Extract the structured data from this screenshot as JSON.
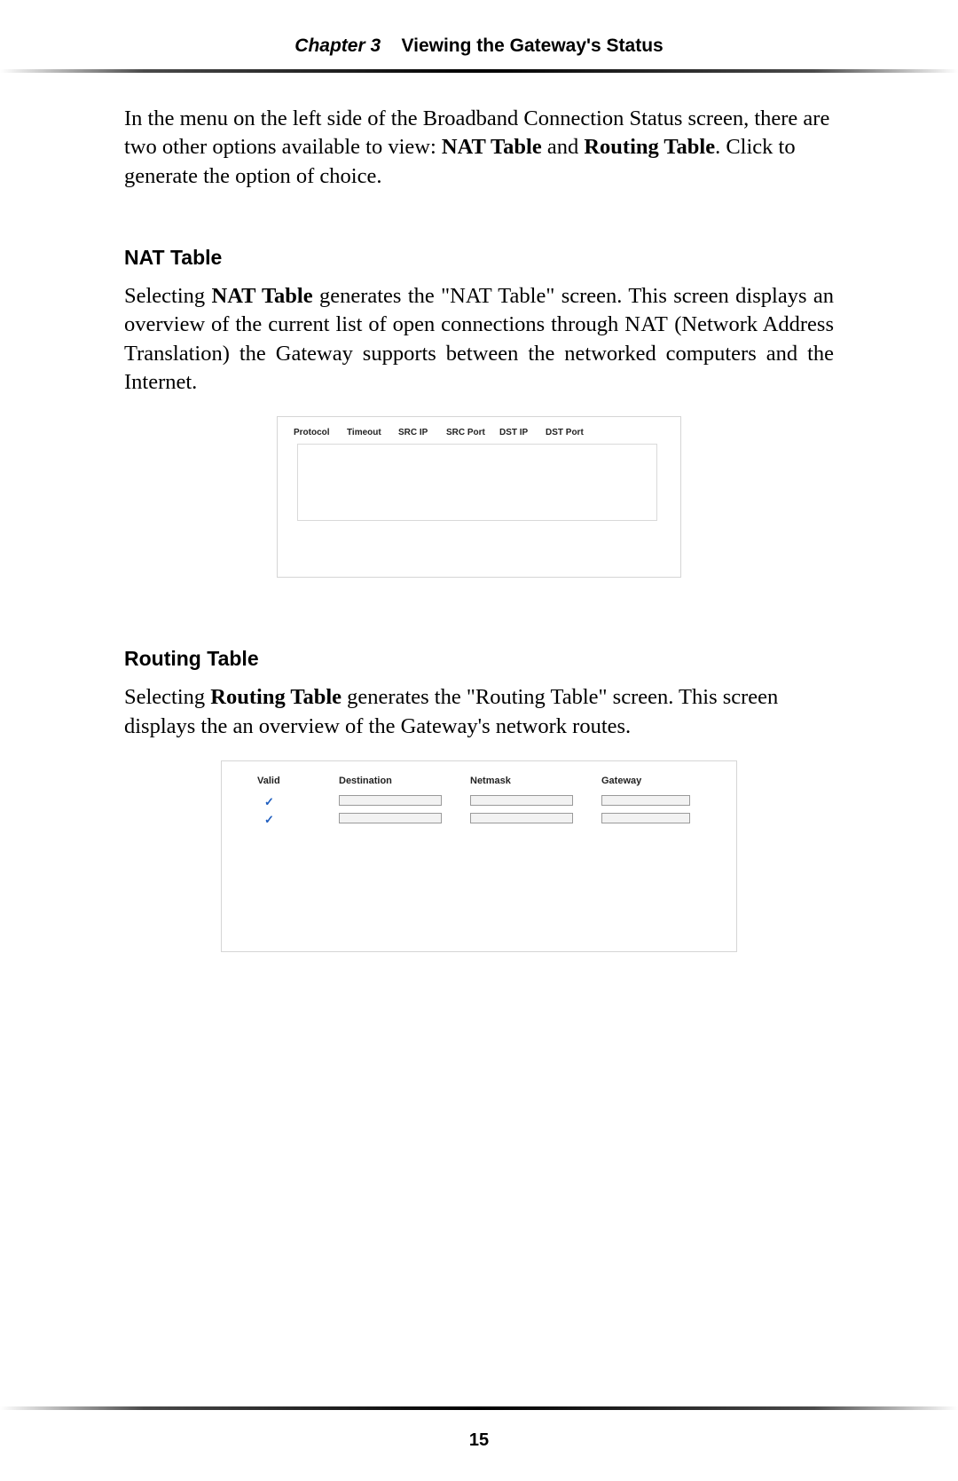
{
  "header": {
    "chapter": "Chapter 3",
    "title": "Viewing the Gateway's Status"
  },
  "intro": {
    "part1": "In the menu on the left side of the Broadband Connection Status screen, there are two other options available to view: ",
    "bold1": "NAT Table",
    "part2": " and ",
    "bold2": "Routing Table",
    "part3": ". Click to generate  the option of choice."
  },
  "nat": {
    "heading": "NAT Table",
    "para_a": "Selecting ",
    "para_bold": "NAT Table",
    "para_b": " generates the \"NAT Table\" screen. This screen displays an overview of the current list of open connections through ",
    "para_sc": "NAT",
    "para_c": " (Network Address Translation) the Gateway supports between the networked computers and the Internet.",
    "table_headers": {
      "protocol": "Protocol",
      "timeout": "Timeout",
      "src_ip": "SRC IP",
      "src_port": "SRC Port",
      "dst_ip": "DST IP",
      "dst_port": "DST Port"
    }
  },
  "routing": {
    "heading": "Routing Table",
    "para_a": "Selecting ",
    "para_bold": "Routing Table",
    "para_b": " generates the \"Routing Table\" screen. This screen displays the an overview of the Gateway's network routes.",
    "table_headers": {
      "valid": "Valid",
      "destination": "Destination",
      "netmask": "Netmask",
      "gateway": "Gateway"
    },
    "rows": [
      {
        "valid": "✓",
        "destination": "",
        "netmask": "",
        "gateway": ""
      },
      {
        "valid": "✓",
        "destination": "",
        "netmask": "",
        "gateway": ""
      }
    ]
  },
  "page_number": "15"
}
